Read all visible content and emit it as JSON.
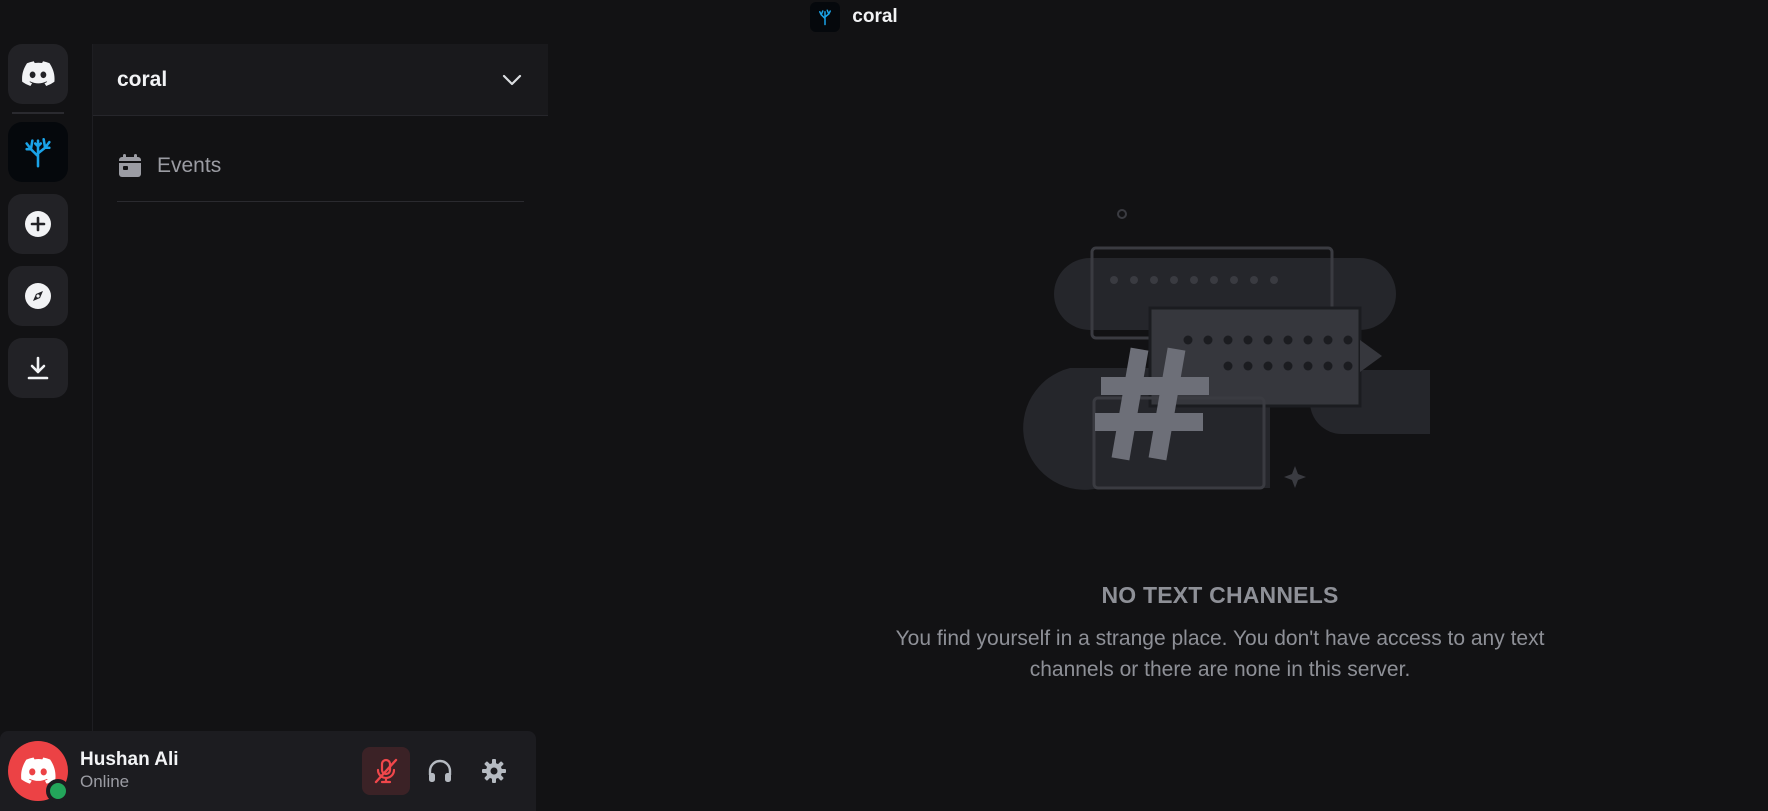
{
  "window": {
    "title": "coral",
    "title_icon": "coral-server-icon"
  },
  "server_rail": {
    "items": [
      {
        "name": "direct-messages",
        "icon": "discord-logo-icon"
      },
      {
        "name": "server-coral",
        "icon": "coral-tree-icon",
        "accent": "#1aa3e8"
      },
      {
        "name": "add-server",
        "icon": "plus-circle-icon"
      },
      {
        "name": "discover",
        "icon": "compass-icon"
      },
      {
        "name": "download-apps",
        "icon": "download-icon"
      }
    ]
  },
  "sidebar": {
    "guild_name": "coral",
    "events_label": "Events"
  },
  "user_panel": {
    "username": "Hushan Ali",
    "status": "Online",
    "status_color": "#23a55a",
    "avatar_color": "#ec4245",
    "controls": [
      {
        "name": "microphone-muted",
        "icon": "microphone-slash-icon",
        "color": "#f0474b"
      },
      {
        "name": "headphones",
        "icon": "headphones-icon"
      },
      {
        "name": "user-settings",
        "icon": "gear-icon"
      }
    ]
  },
  "main": {
    "empty_title": "NO TEXT CHANNELS",
    "empty_description": "You find yourself in a strange place. You don't have access to any text channels or there are none in this server."
  }
}
